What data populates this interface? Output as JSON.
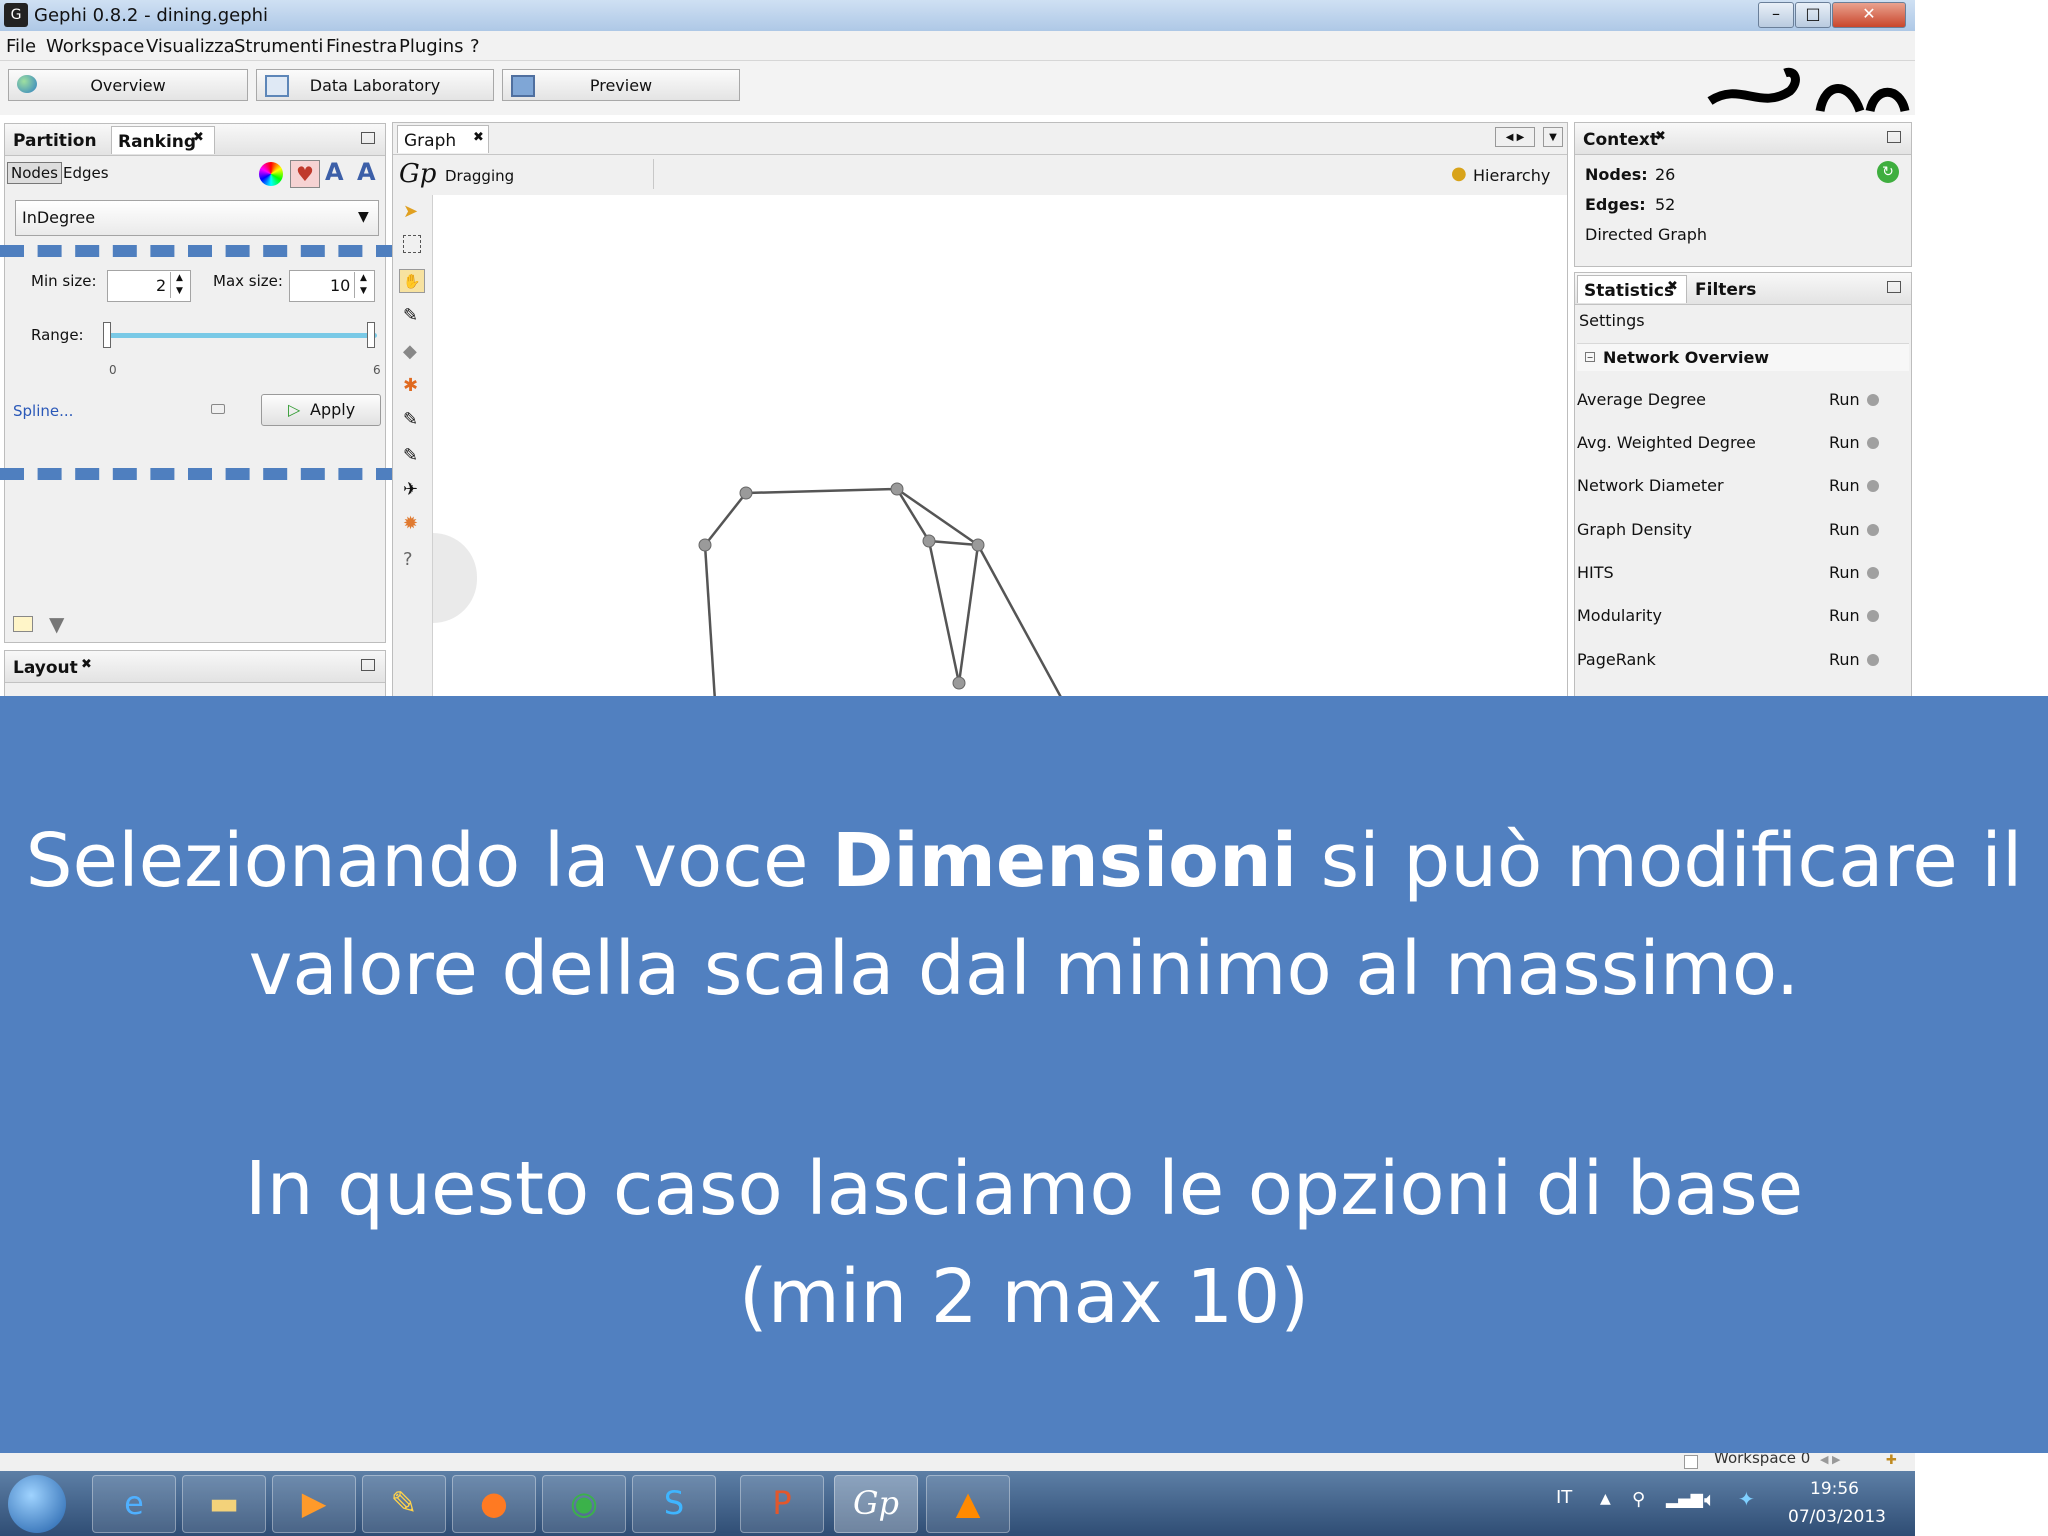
{
  "window": {
    "title": "Gephi 0.8.2 - dining.gephi"
  },
  "menu": [
    "File",
    "Workspace",
    "Visualizza",
    "Strumenti",
    "Finestra",
    "Plugins",
    "?"
  ],
  "workspace_tabs": [
    "Overview",
    "Data Laboratory",
    "Preview"
  ],
  "left_panel": {
    "tabs": [
      "Partition",
      "Ranking"
    ],
    "subtabs": [
      "Nodes",
      "Edges"
    ],
    "attribute": "InDegree",
    "min_label": "Min size:",
    "min_value": "2",
    "max_label": "Max size:",
    "max_value": "10",
    "range_label": "Range:",
    "range_min": "0",
    "range_max": "6",
    "spline": "Spline...",
    "apply": "Apply"
  },
  "layout_panel": {
    "title": "Layout"
  },
  "graph_panel": {
    "tab": "Graph",
    "mode": "Dragging",
    "hierarchy": "Hierarchy"
  },
  "context": {
    "title": "Context",
    "nodes_label": "Nodes:",
    "nodes": "26",
    "edges_label": "Edges:",
    "edges": "52",
    "type": "Directed Graph"
  },
  "statistics": {
    "tabs": [
      "Statistics",
      "Filters"
    ],
    "settings": "Settings",
    "section": "Network Overview",
    "run_label": "Run",
    "items": [
      "Average Degree",
      "Avg. Weighted Degree",
      "Network Diameter",
      "Graph Density",
      "HITS",
      "Modularity",
      "PageRank"
    ]
  },
  "overlay": {
    "line1_a": "Selezionando la voce ",
    "line1_bold": "Dimensioni",
    "line1_b": " si può modificare il",
    "line2": "valore della scala dal minimo al massimo.",
    "line3": "In questo caso lasciamo le opzioni di base",
    "line4": "(min 2 max 10)"
  },
  "bottom_strip": {
    "workspace": "Workspace 0"
  },
  "taskbar": {
    "language": "IT",
    "time": "19:56",
    "date": "07/03/2013"
  },
  "colors": {
    "accent": "#5180c0",
    "arrow": "#4f7fbf"
  }
}
